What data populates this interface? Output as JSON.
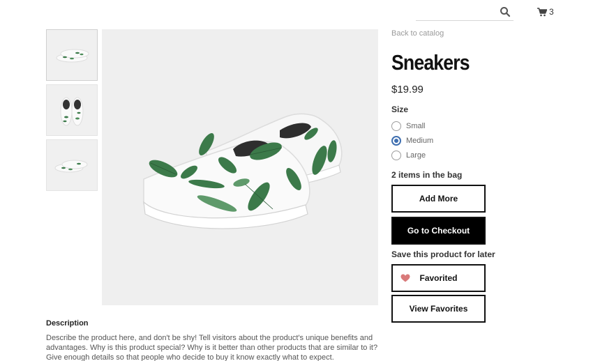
{
  "header": {
    "search_icon": "search-icon",
    "cart_icon": "cart-icon",
    "cart_count": "3"
  },
  "gallery": {
    "thumbnails": [
      "sneakers-pair-side",
      "sneakers-pair-top",
      "sneakers-pair-back"
    ],
    "main_image": "sneakers-pair-side"
  },
  "product": {
    "back_link": "Back to catalog",
    "title": "Sneakers",
    "price": "$19.99",
    "size_label": "Size",
    "sizes": [
      {
        "label": "Small",
        "selected": false
      },
      {
        "label": "Medium",
        "selected": true
      },
      {
        "label": "Large",
        "selected": false
      }
    ],
    "bag_count": "2 items in the bag",
    "add_more": "Add More",
    "checkout": "Go to Checkout",
    "save_label": "Save this product for later",
    "favorited": "Favorited",
    "view_favorites": "View Favorites"
  },
  "description": {
    "title": "Description",
    "text": "Describe the product here, and don't be shy! Tell visitors about the product's unique benefits and advantages. Why is this product special? Why is it better than other products that are similar to it? Give enough details so that people who decide to buy it know exactly what to expect."
  },
  "colors": {
    "accent": "#3f6fb0",
    "heart": "#d97a7a",
    "leaf": "#3c7a4a",
    "checkout_bg": "#000000"
  }
}
